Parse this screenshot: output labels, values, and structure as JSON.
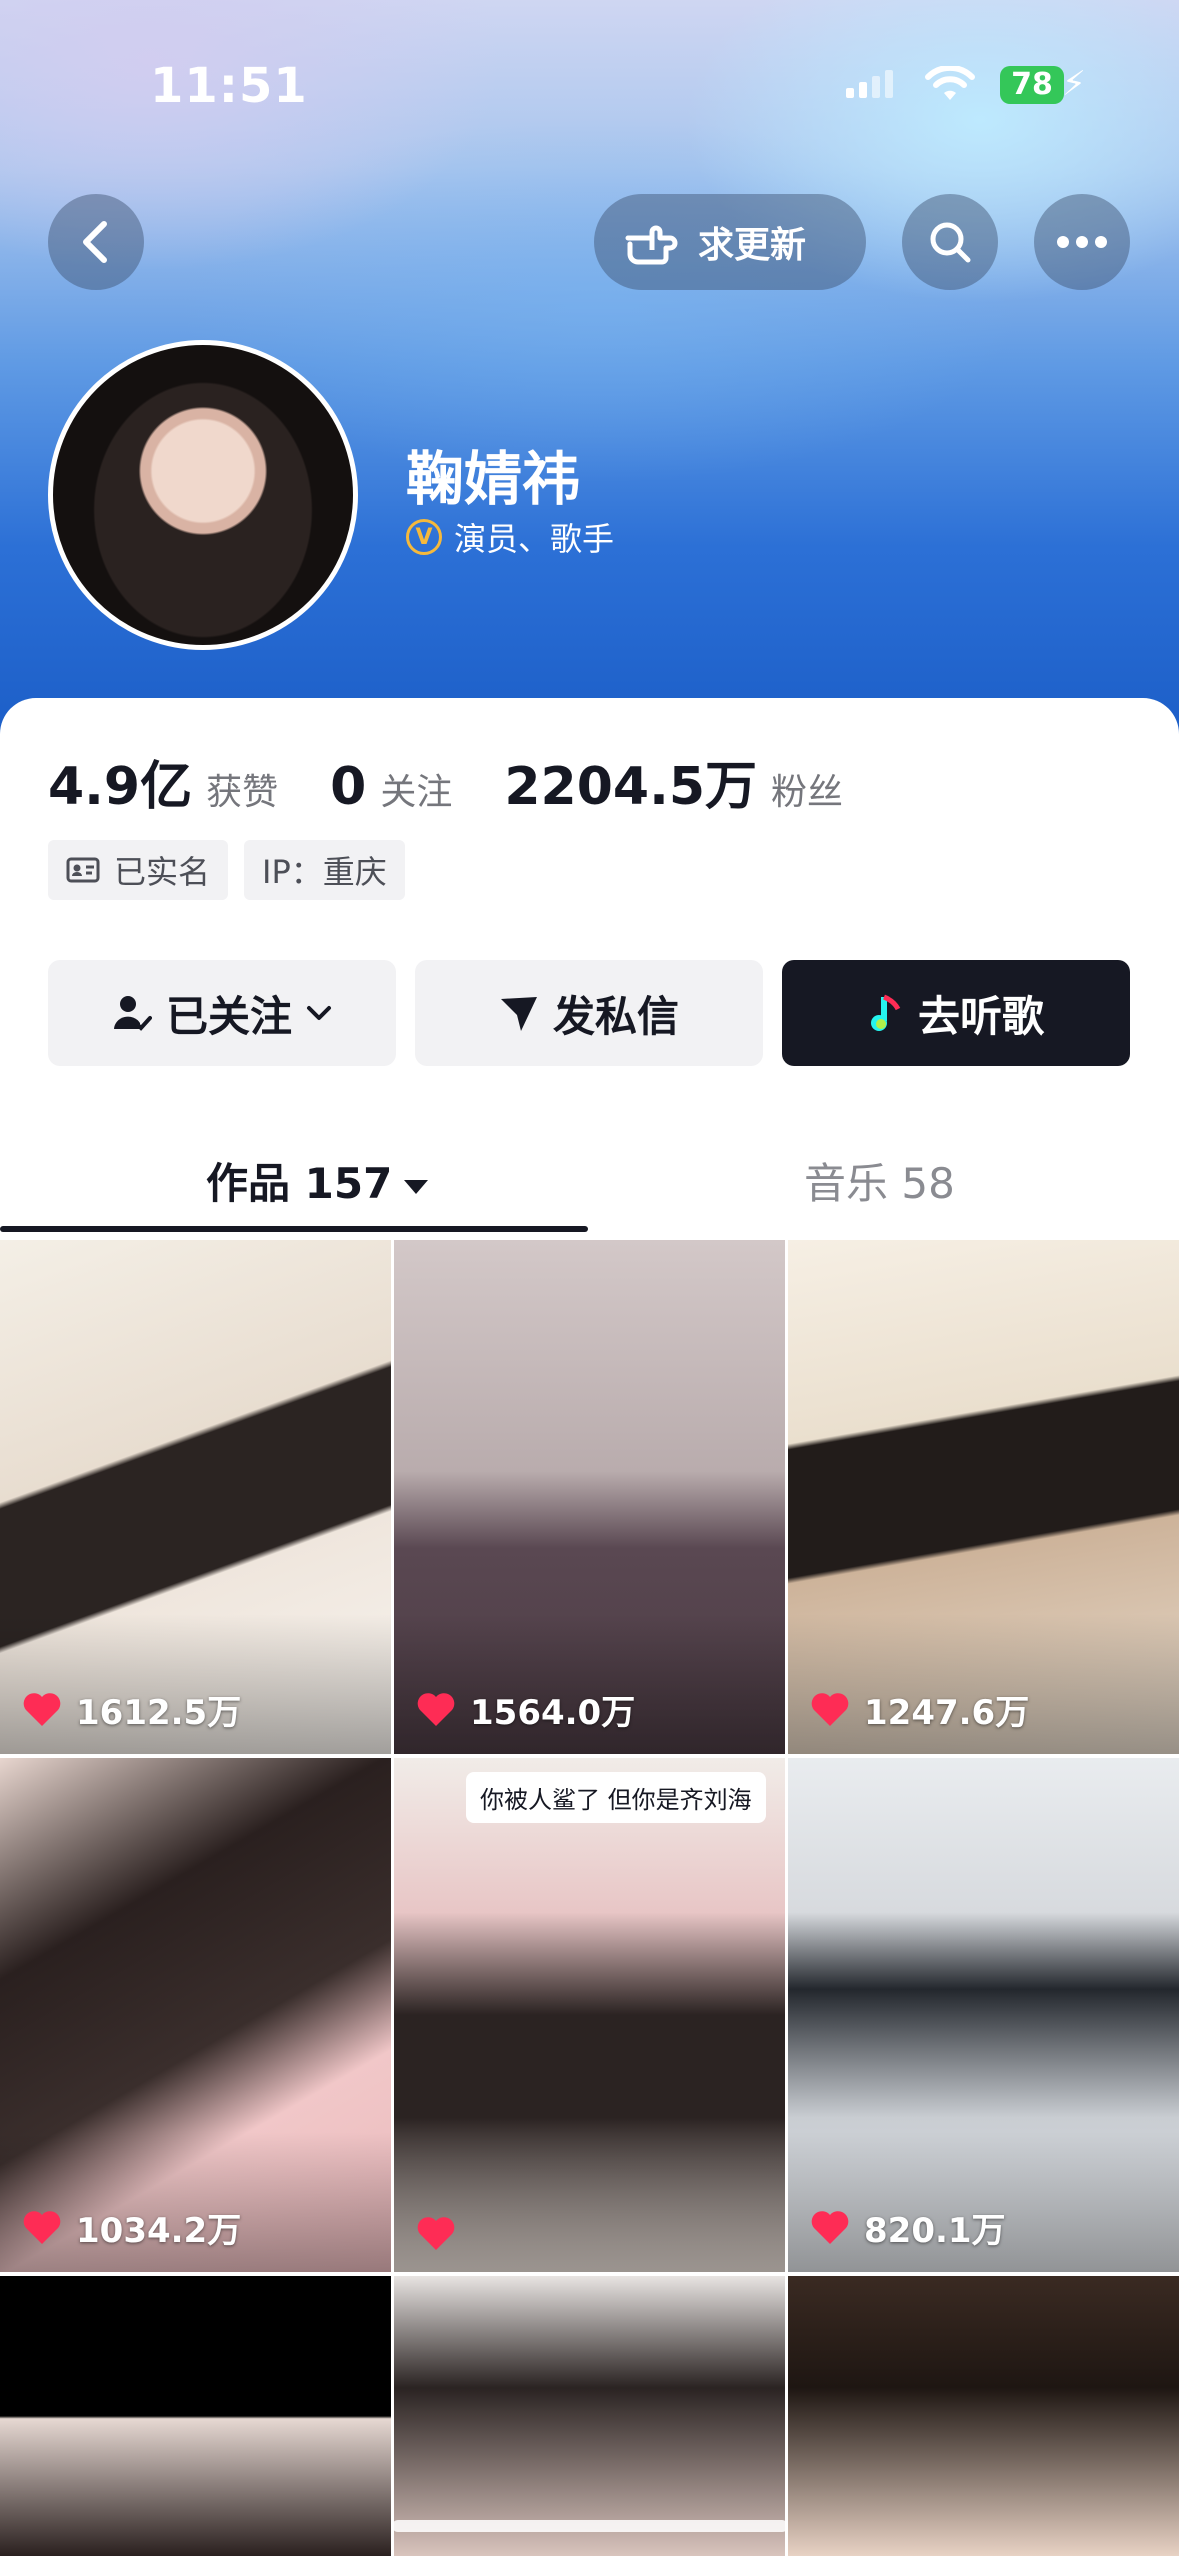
{
  "status_bar": {
    "time": "11:51",
    "battery": "78"
  },
  "header": {
    "update_label": "求更新"
  },
  "profile": {
    "name": "鞠婧祎",
    "verify_badge": "V",
    "verify_text": "演员、歌手"
  },
  "stats": [
    {
      "value": "4.9亿",
      "label": "获赞"
    },
    {
      "value": "0",
      "label": "关注"
    },
    {
      "value": "2204.5万",
      "label": "粉丝"
    }
  ],
  "tags": {
    "real_name": "已实名",
    "ip": "IP：重庆"
  },
  "actions": {
    "followed": "已关注",
    "message": "发私信",
    "listen": "去听歌"
  },
  "tabs": {
    "works_label": "作品 157",
    "music_label": "音乐 58"
  },
  "videos": [
    {
      "likes": "1612.5万"
    },
    {
      "likes": "1564.0万"
    },
    {
      "likes": "1247.6万"
    },
    {
      "likes": "1034.2万"
    },
    {
      "likes": "",
      "caption": "你被人鲨了 但你是齐刘海"
    },
    {
      "likes": "820.1万"
    },
    {
      "likes": ""
    },
    {
      "likes": ""
    },
    {
      "likes": ""
    }
  ],
  "colors": {
    "accent_dark": "#161823",
    "like_red": "#fe2c55",
    "battery_green": "#34c759",
    "verify_gold": "#f5b93c"
  }
}
